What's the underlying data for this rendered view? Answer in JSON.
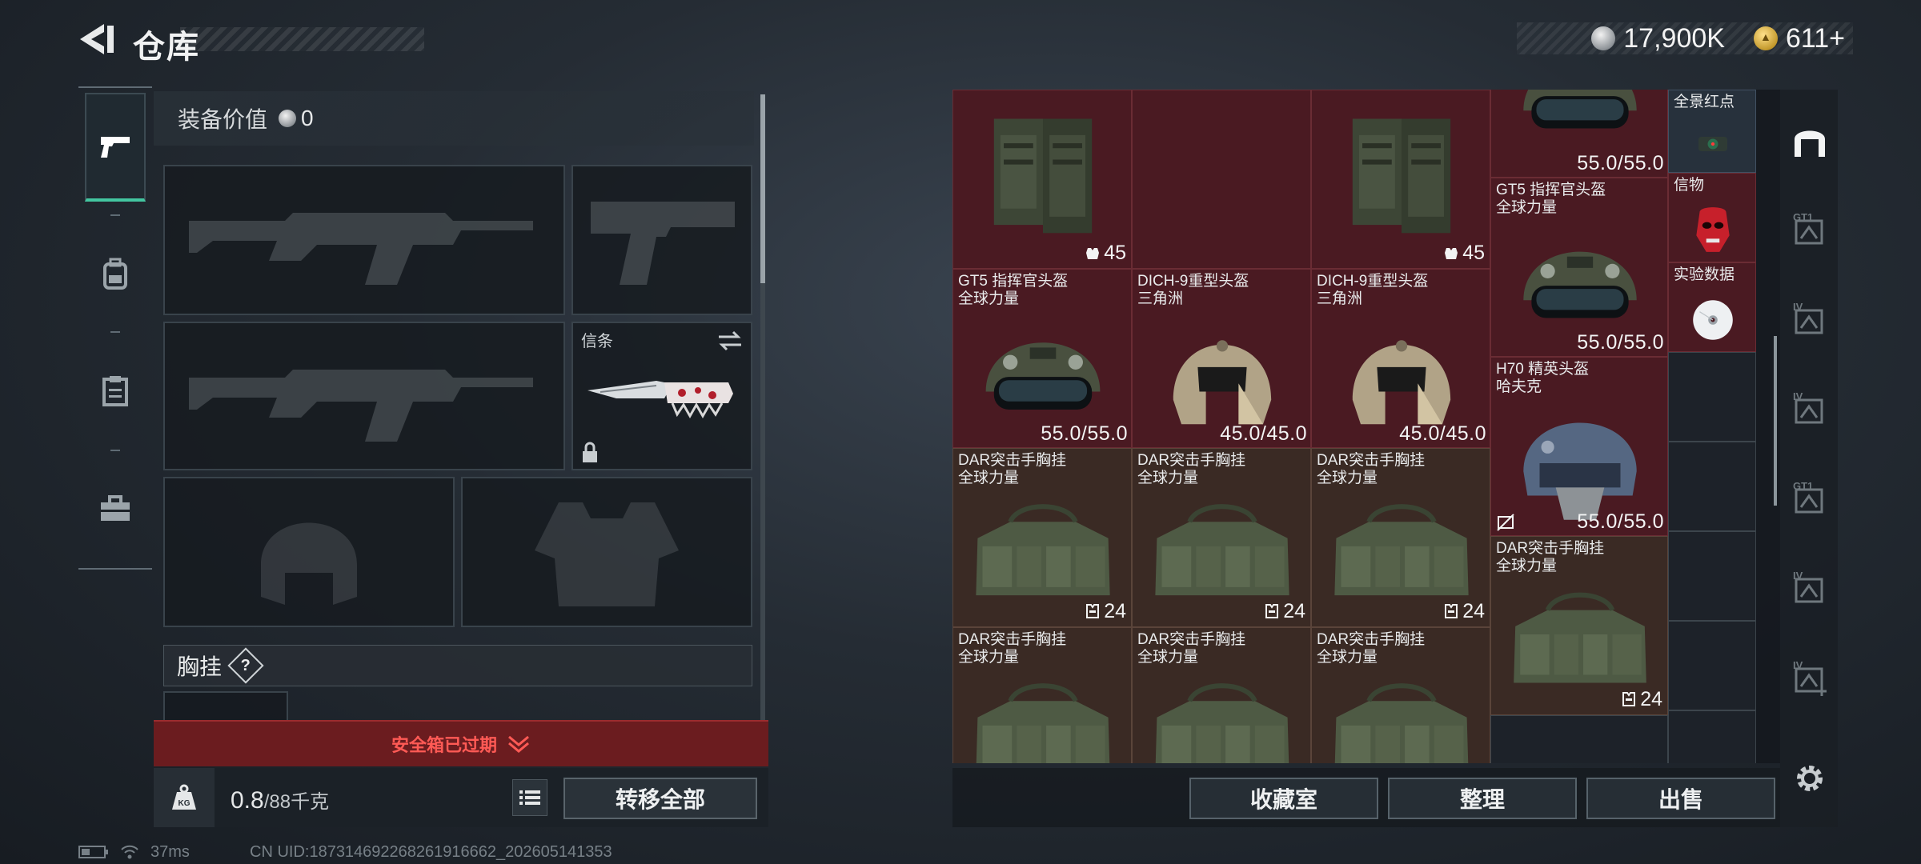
{
  "header": {
    "title": "仓库",
    "currency": [
      {
        "icon": "silver-coin-icon",
        "value": "17,900K"
      },
      {
        "icon": "gold-coin-icon",
        "value": "611+"
      }
    ]
  },
  "left_nav": {
    "items": [
      {
        "icon": "pistol-icon",
        "active": true
      },
      {
        "icon": "backpack-icon",
        "active": false
      },
      {
        "icon": "clipboard-icon",
        "active": false
      },
      {
        "icon": "toolbox-icon",
        "active": false
      }
    ]
  },
  "loadout": {
    "equip_value_label": "装备价值",
    "equip_value": "0",
    "melee_slot_label": "信条",
    "section_title": "胸挂",
    "help_symbol": "?",
    "safebox_text": "安全箱已过期",
    "weight_current": "0.8",
    "weight_max": "/88千克",
    "weight_icon_label": "KG",
    "transfer_all_label": "转移全部"
  },
  "storage": {
    "items": [
      {
        "id": "vest-1",
        "name": "",
        "stat": "45",
        "stat_icon": "armor-icon",
        "type": "vest",
        "bg": "red"
      },
      {
        "id": "vest-2",
        "name": "",
        "stat": "45",
        "stat_icon": "armor-icon",
        "type": "vest",
        "bg": "red"
      },
      {
        "id": "helmet-top",
        "name": "",
        "stat": "55.0/55.0",
        "type": "helmet-green",
        "bg": "red"
      },
      {
        "id": "red-dot",
        "name": "全景红点",
        "stat": "",
        "type": "sight",
        "bg": "blue"
      },
      {
        "id": "gt5-big",
        "name": "GT5 指挥官头盔\n全球力量",
        "stat": "55.0/55.0",
        "type": "helmet-green",
        "bg": "red"
      },
      {
        "id": "token",
        "name": "信物",
        "stat": "",
        "type": "mask",
        "bg": "red"
      },
      {
        "id": "data",
        "name": "实验数据",
        "stat": "",
        "type": "disc",
        "bg": "red"
      },
      {
        "id": "gt5",
        "name": "GT5 指挥官头盔\n全球力量",
        "stat": "55.0/55.0",
        "type": "helmet-green",
        "bg": "red"
      },
      {
        "id": "dich-1",
        "name": "DICH-9重型头盔\n三角洲",
        "stat": "45.0/45.0",
        "type": "helmet-tan",
        "bg": "red"
      },
      {
        "id": "dich-2",
        "name": "DICH-9重型头盔\n三角洲",
        "stat": "45.0/45.0",
        "type": "helmet-tan",
        "bg": "red"
      },
      {
        "id": "h70",
        "name": "H70 精英头盔\n哈夫克",
        "stat": "55.0/55.0",
        "type": "helmet-blue",
        "bg": "red"
      },
      {
        "id": "dar-1",
        "name": "DAR突击手胸挂\n全球力量",
        "stat": "24",
        "stat_icon": "vest-capacity-icon",
        "type": "rig",
        "bg": "brown"
      },
      {
        "id": "dar-2",
        "name": "DAR突击手胸挂\n全球力量",
        "stat": "24",
        "stat_icon": "vest-capacity-icon",
        "type": "rig",
        "bg": "brown"
      },
      {
        "id": "dar-3",
        "name": "DAR突击手胸挂\n全球力量",
        "stat": "24",
        "stat_icon": "vest-capacity-icon",
        "type": "rig",
        "bg": "brown"
      },
      {
        "id": "dar-big",
        "name": "DAR突击手胸挂\n全球力量",
        "stat": "24",
        "stat_icon": "vest-capacity-icon",
        "type": "rig",
        "bg": "brown"
      },
      {
        "id": "dar-4",
        "name": "DAR突击手胸挂\n全球力量",
        "stat": "",
        "type": "rig",
        "bg": "brown"
      },
      {
        "id": "dar-5",
        "name": "DAR突击手胸挂\n全球力量",
        "stat": "",
        "type": "rig",
        "bg": "brown"
      },
      {
        "id": "dar-6",
        "name": "DAR突击手胸挂\n全球力量",
        "stat": "",
        "type": "rig",
        "bg": "brown"
      }
    ]
  },
  "category_bar": {
    "items": [
      {
        "icon": "home-storage-icon",
        "label": ""
      },
      {
        "icon": "storage-gt1-icon",
        "label": "GT1"
      },
      {
        "icon": "storage-iv-icon",
        "label": "IV"
      },
      {
        "icon": "storage-iv-2-icon",
        "label": "IV"
      },
      {
        "icon": "storage-gt1-2-icon",
        "label": "GT1"
      },
      {
        "icon": "storage-iv-3-icon",
        "label": "IV"
      },
      {
        "icon": "storage-iv-add-icon",
        "label": "IV"
      },
      {
        "icon": "gear-icon",
        "label": ""
      }
    ]
  },
  "actions": {
    "collection_label": "收藏室",
    "sort_label": "整理",
    "sell_label": "出售"
  },
  "status": {
    "ping": "37ms",
    "uid": "CN UID:187314692268261916662_202605141353"
  },
  "colors": {
    "accent_active": "#43c6a0",
    "item_red": "#4a1a22",
    "item_brown": "#3a2a24",
    "warning_red": "#ff5a55"
  }
}
